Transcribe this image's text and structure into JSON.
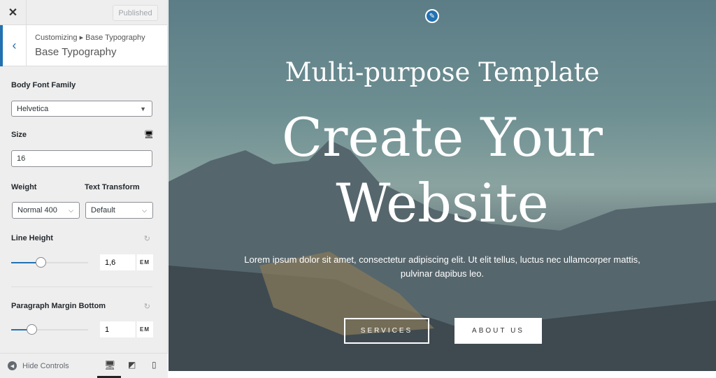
{
  "sidebar": {
    "published_label": "Published",
    "breadcrumb": "Customizing ▸ Base Typography",
    "section_title": "Base Typography",
    "body_font_family": {
      "label": "Body Font Family",
      "value": "Helvetica"
    },
    "size": {
      "label": "Size",
      "value": "16"
    },
    "weight": {
      "label": "Weight",
      "value": "Normal 400"
    },
    "text_transform": {
      "label": "Text Transform",
      "value": "Default"
    },
    "line_height": {
      "label": "Line Height",
      "value": "1,6",
      "unit": "EM",
      "slider_fraction": 0.38
    },
    "paragraph_margin": {
      "label": "Paragraph Margin Bottom",
      "value": "1",
      "unit": "EM",
      "slider_fraction": 0.26
    },
    "hide_controls": "Hide Controls",
    "active_device": "desktop",
    "accent": "#2271b1"
  },
  "hero": {
    "subtitle": "Multi-purpose Template",
    "title": "Create Your Website",
    "text": "Lorem ipsum dolor sit amet, consectetur adipiscing elit. Ut elit tellus, luctus nec ullamcorper mattis, pulvinar dapibus leo.",
    "button1": "SERVICES",
    "button2": "ABOUT US"
  }
}
